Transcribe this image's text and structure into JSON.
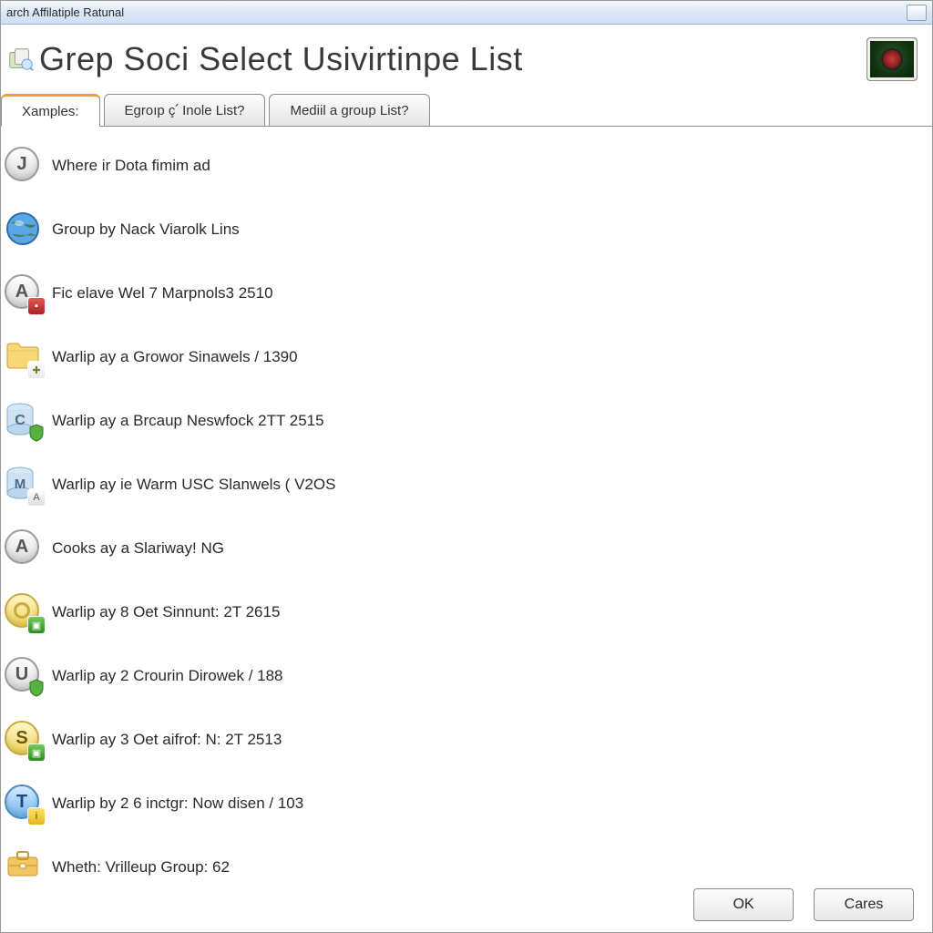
{
  "window": {
    "title": "arch Affilatiple Ratunal"
  },
  "header": {
    "title": "Grep Soci Select Usivirtinpe List"
  },
  "tabs": [
    {
      "label": "Xamples:",
      "active": true
    },
    {
      "label": "Egroıp ç՛ Inole List?",
      "active": false
    },
    {
      "label": "Mediil a group List?",
      "active": false
    }
  ],
  "items": [
    {
      "icon": "letter-J",
      "text": "Where ir Dota fimim ad"
    },
    {
      "icon": "globe-blue",
      "text": "Group by Nack Viarolk Lins"
    },
    {
      "icon": "letter-A-redbadge",
      "text": "Fic elave Wel 7 Marpnols3 2510"
    },
    {
      "icon": "folder-cross",
      "text": "Warlip ay a Growor Sinawels / 1390"
    },
    {
      "icon": "cylinder-C-greenshield",
      "text": "Warlip ay a Brcaup Neswfock 2TT 2515"
    },
    {
      "icon": "cylinder-M-abadge",
      "text": "Warlip ay ie Warm USC Slanwels ( V2OS"
    },
    {
      "icon": "letter-A",
      "text": "Cooks ay a Slariway! NG"
    },
    {
      "icon": "coin-ring-greenbadge",
      "text": "Warlip ay 8 Oet Sinnunt: 2T 2615"
    },
    {
      "icon": "letter-U-greenshield",
      "text": "Warlip ay 2 Crourin Dirowek / 188"
    },
    {
      "icon": "letter-S-yellow-greenbadge",
      "text": "Warlip ay 3 Oet aifrof: N: 2T 2513"
    },
    {
      "icon": "letter-T-blue-yellowbadge",
      "text": "Warlip by 2 6 inctgr: Now disen / 103"
    },
    {
      "icon": "briefcase",
      "text": "Wheth: Vrilleup Group: 62"
    }
  ],
  "footer": {
    "ok": "OK",
    "cancel": "Cares"
  }
}
